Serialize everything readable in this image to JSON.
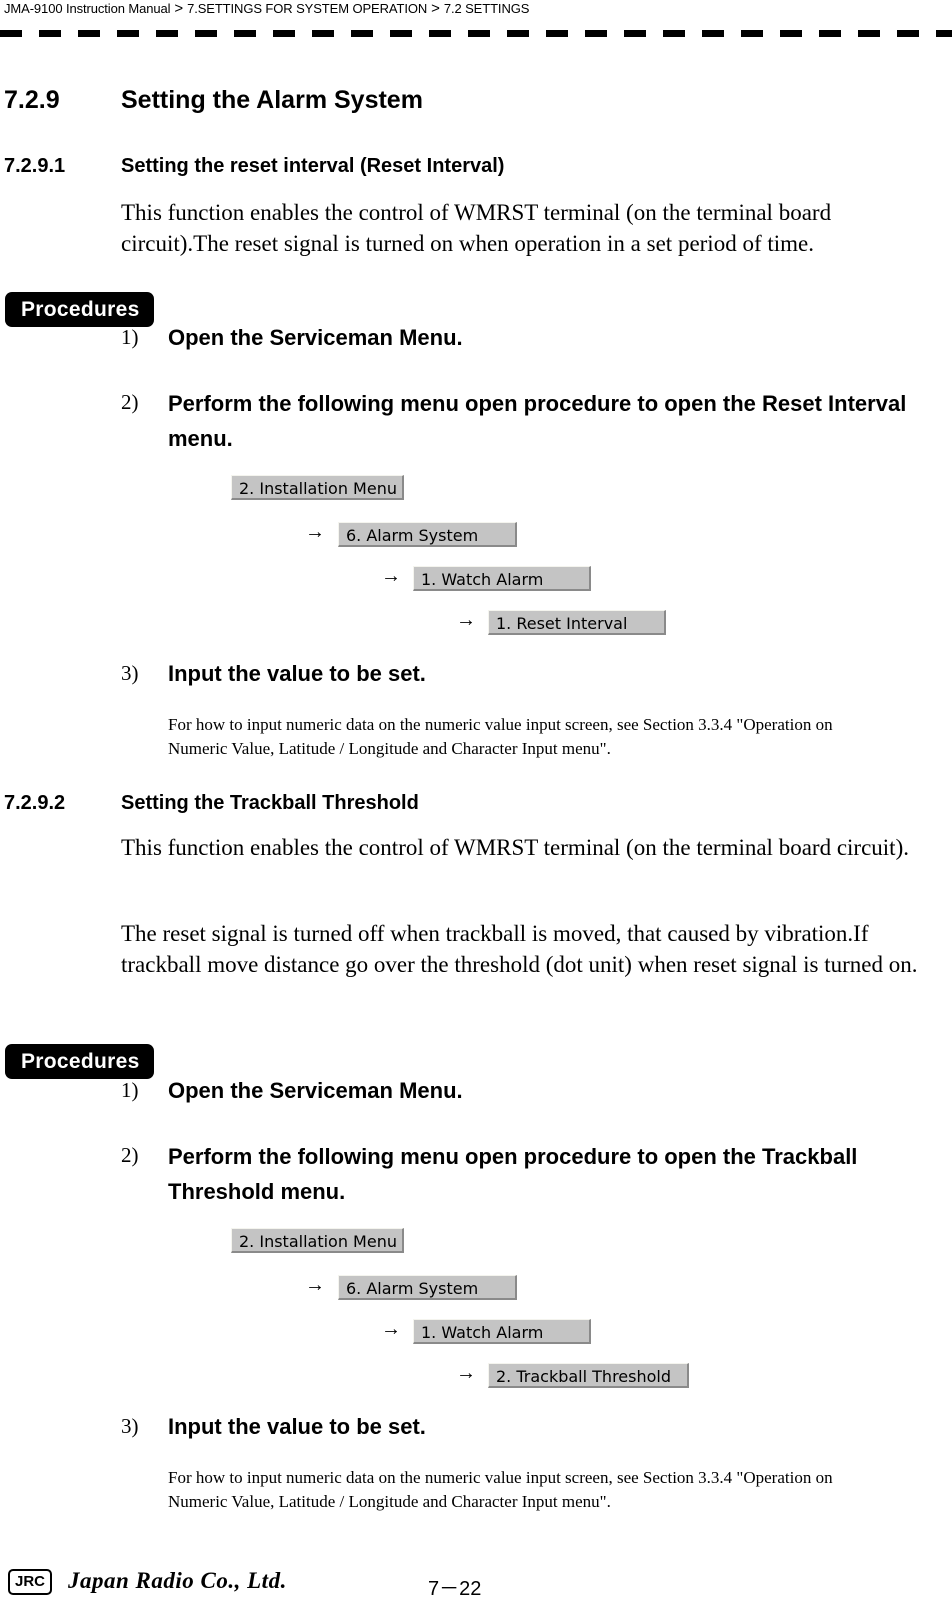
{
  "header": {
    "breadcrumb": [
      "JMA-9100 Instruction Manual",
      "7.SETTINGS FOR SYSTEM OPERATION",
      "7.2  SETTINGS"
    ],
    "separator": ">"
  },
  "section": {
    "number": "7.2.9",
    "title": "Setting the Alarm System"
  },
  "subsections": [
    {
      "number": "7.2.9.1",
      "title": "Setting the reset interval (Reset Interval)",
      "paragraphs": [
        "This function enables the control of WMRST terminal (on the terminal board circuit).The reset signal is turned on when operation in a set period of time."
      ],
      "procedures_label": "Procedures",
      "steps": [
        {
          "num": "1)",
          "text": "Open the Serviceman Menu."
        },
        {
          "num": "2)",
          "text": "Perform the following menu open procedure to open the Reset Interval menu."
        },
        {
          "num": "3)",
          "text": "Input the value to be set."
        }
      ],
      "menu_path": [
        "2. Installation Menu",
        "6. Alarm System",
        "1. Watch Alarm",
        "1. Reset Interval"
      ],
      "arrow": "→",
      "note": "For how to input numeric data on the numeric value input screen, see Section 3.3.4 \"Operation on Numeric Value, Latitude / Longitude and Character Input menu\"."
    },
    {
      "number": "7.2.9.2",
      "title": "Setting the Trackball Threshold",
      "paragraphs": [
        "This function enables the control of WMRST terminal (on the terminal board circuit).",
        "The reset signal is turned off when trackball is moved, that caused by vibration.If trackball move distance go over the threshold (dot unit) when reset signal is turned on."
      ],
      "procedures_label": "Procedures",
      "steps": [
        {
          "num": "1)",
          "text": "Open the Serviceman Menu."
        },
        {
          "num": "2)",
          "text": "Perform the following menu open procedure to open the Trackball Threshold menu."
        },
        {
          "num": "3)",
          "text": "Input the value to be set."
        }
      ],
      "menu_path": [
        "2. Installation Menu",
        "6. Alarm System",
        "1. Watch Alarm",
        "2. Trackball Threshold"
      ],
      "arrow": "→",
      "note": "For how to input numeric data on the numeric value input screen, see Section 3.3.4 \"Operation on Numeric Value, Latitude / Longitude and Character Input menu\"."
    }
  ],
  "footer": {
    "logo_text": "JRC",
    "company": "Japan Radio Co., Ltd.",
    "page_number": "7－22"
  }
}
